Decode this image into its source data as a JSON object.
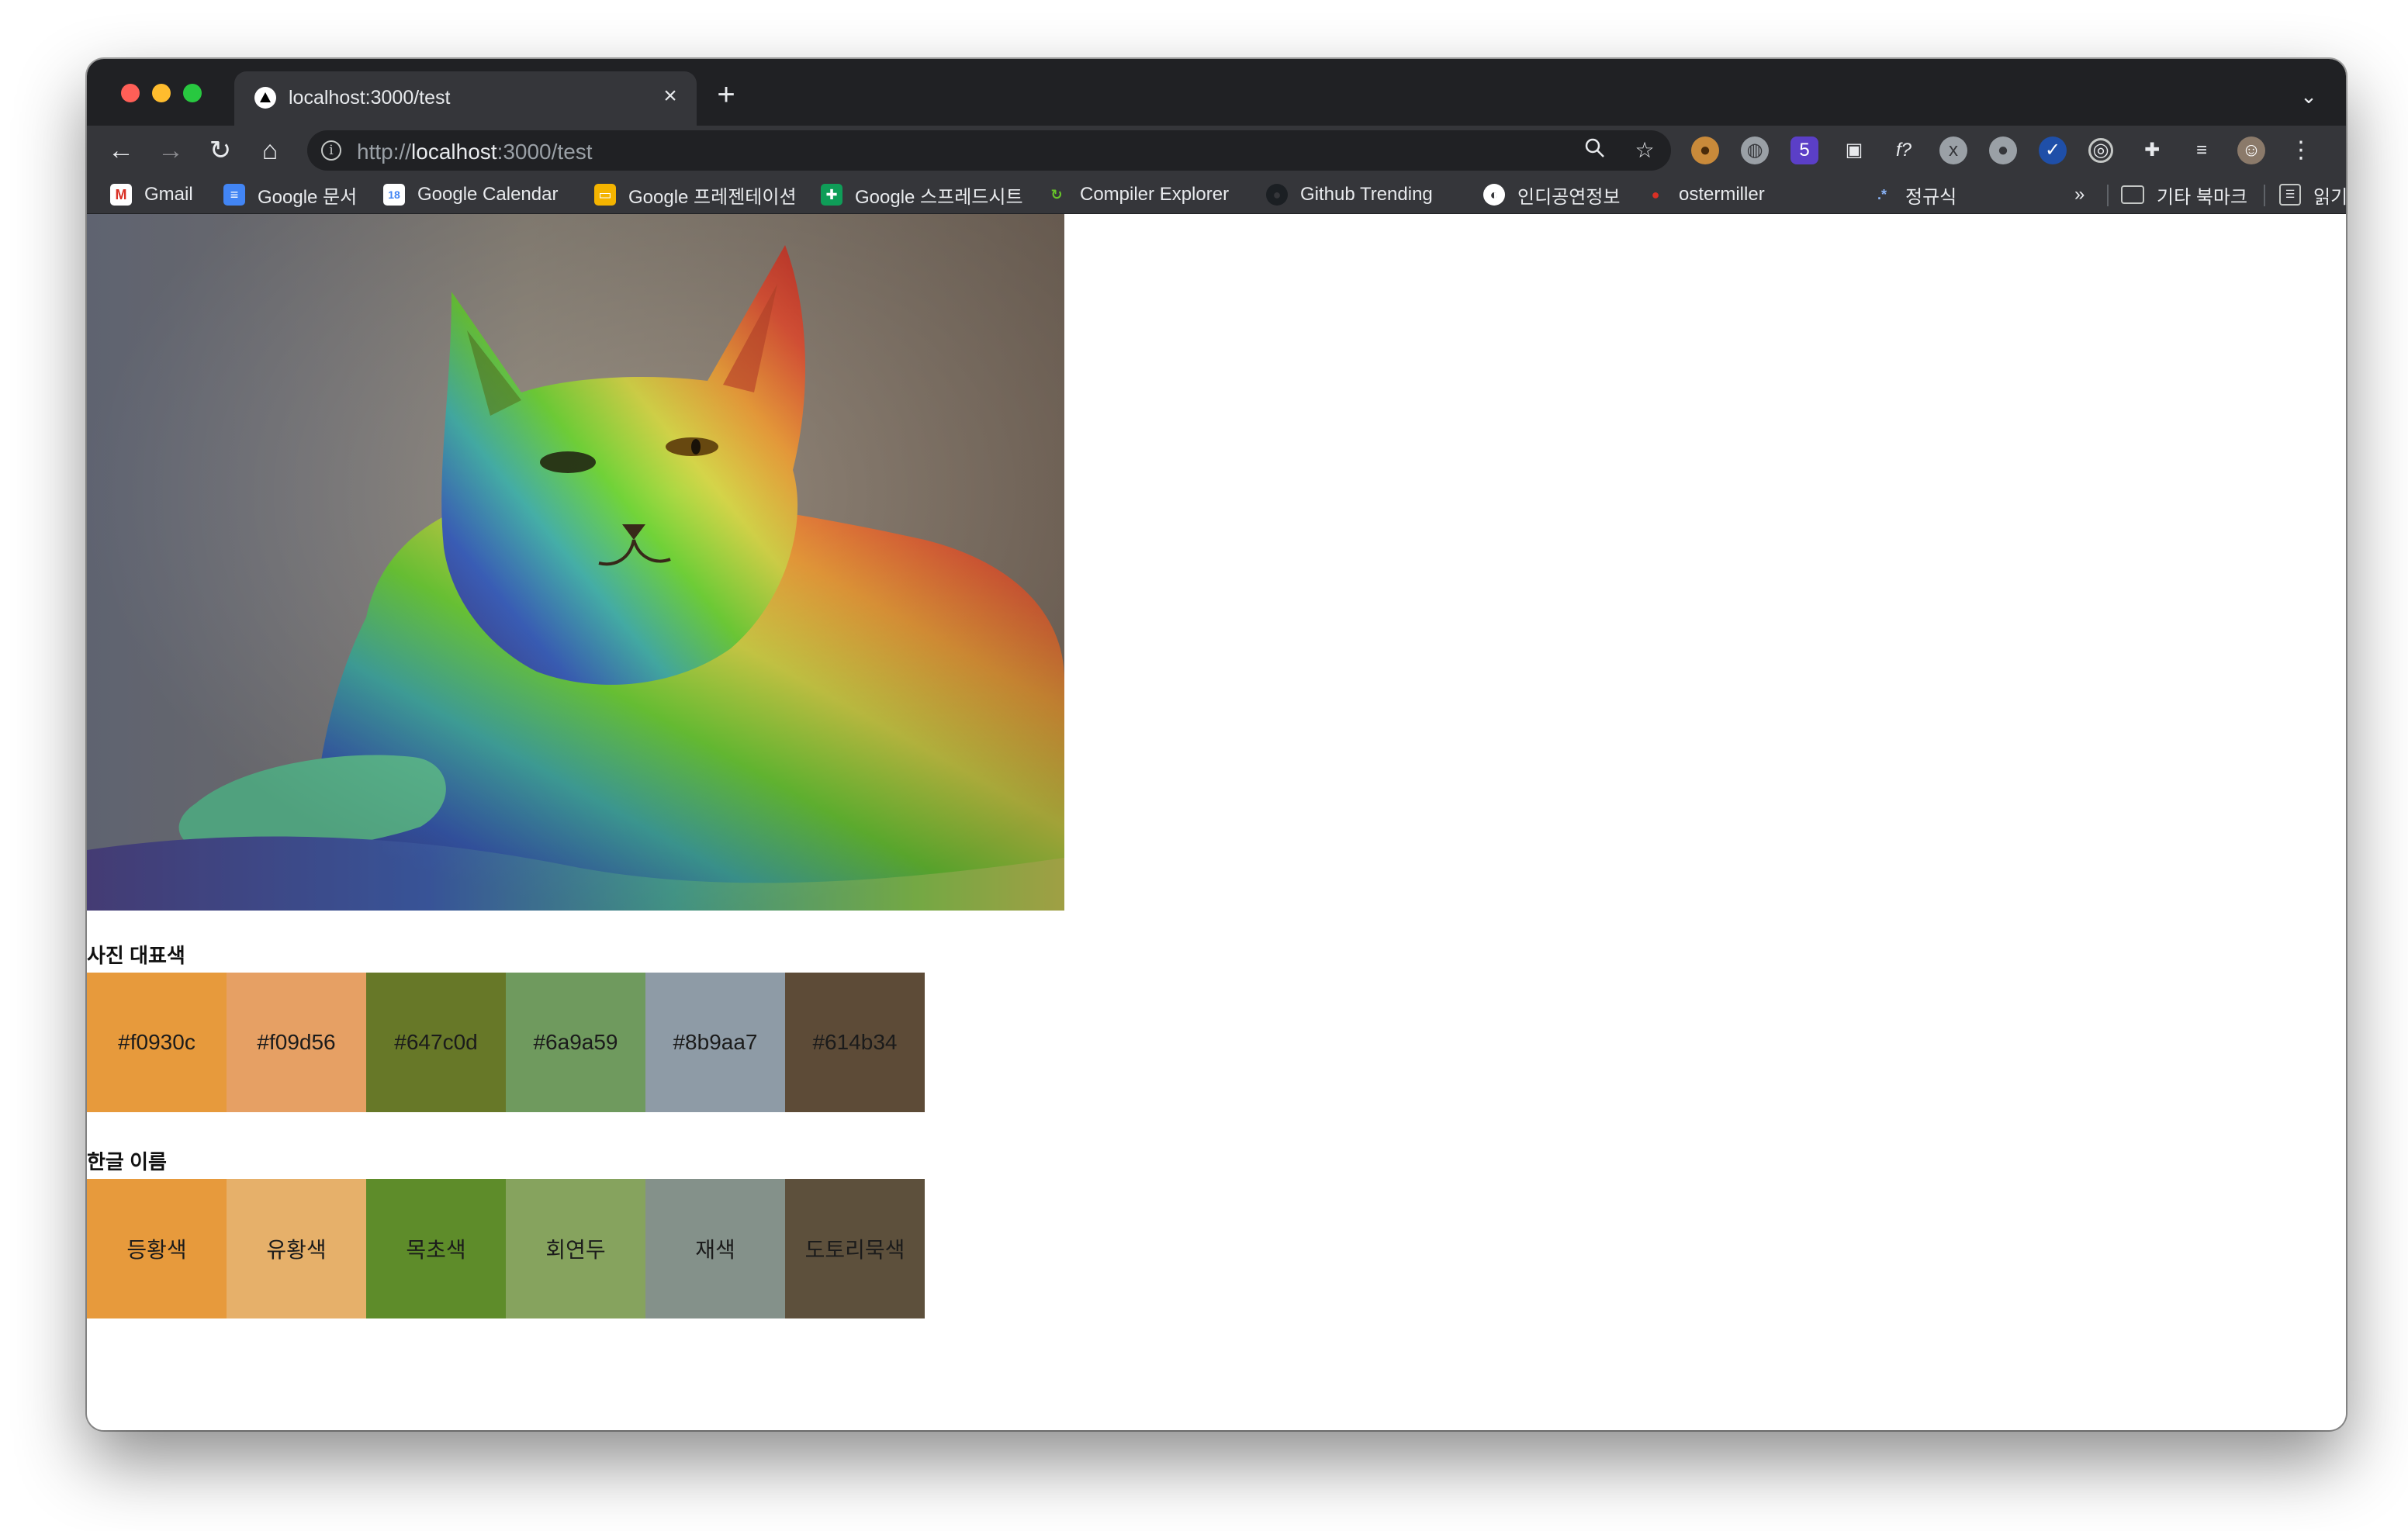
{
  "browser": {
    "tab": {
      "title": "localhost:3000/test",
      "close_icon": "close-icon"
    },
    "new_tab_icon": "plus-icon",
    "tab_list_icon": "chevron-down-icon",
    "toolbar": {
      "back_icon": "back-arrow-icon",
      "forward_icon": "forward-arrow-icon",
      "reload_icon": "reload-icon",
      "home_icon": "home-icon",
      "url_scheme": "http://",
      "url_host": "localhost",
      "url_path": ":3000/test"
    },
    "bookmarks": [
      {
        "label": "Gmail",
        "icon": "gmail-icon"
      },
      {
        "label": "Google 문서",
        "icon": "google-docs-icon"
      },
      {
        "label": "Google Calendar",
        "icon": "google-calendar-icon"
      },
      {
        "label": "Google 프레젠테이션",
        "icon": "google-slides-icon"
      },
      {
        "label": "Google 스프레드시트",
        "icon": "google-sheets-icon"
      },
      {
        "label": "Compiler Explorer",
        "icon": "compiler-explorer-icon"
      },
      {
        "label": "Github Trending",
        "icon": "github-icon"
      },
      {
        "label": "인디공연정보",
        "icon": "globe-icon"
      },
      {
        "label": "ostermiller",
        "icon": "ostermiller-icon"
      },
      {
        "label": "정규식",
        "icon": "regex-icon"
      }
    ],
    "bookmarks_overflow": "»",
    "other_bookmarks": "기타 북마크",
    "reading_list": "읽기 목록"
  },
  "page": {
    "photo_alt": "rainbow cat",
    "palette_title": "사진 대표색",
    "palette": [
      {
        "label": "#f0930c",
        "color": "#e79a3c"
      },
      {
        "label": "#f09d56",
        "color": "#e6a064"
      },
      {
        "label": "#647c0d",
        "color": "#677828"
      },
      {
        "label": "#6a9a59",
        "color": "#6f9a5e"
      },
      {
        "label": "#8b9aa7",
        "color": "#8e9ba6"
      },
      {
        "label": "#614b34",
        "color": "#5d4b37"
      }
    ],
    "names_title": "한글 이름",
    "names": [
      {
        "label": "등황색",
        "color": "#e79a3c"
      },
      {
        "label": "유황색",
        "color": "#e6b06a"
      },
      {
        "label": "목초색",
        "color": "#5e8c2a"
      },
      {
        "label": "회연두",
        "color": "#86a35e"
      },
      {
        "label": "재색",
        "color": "#84918a"
      },
      {
        "label": "도토리묵색",
        "color": "#5d503c"
      }
    ]
  }
}
